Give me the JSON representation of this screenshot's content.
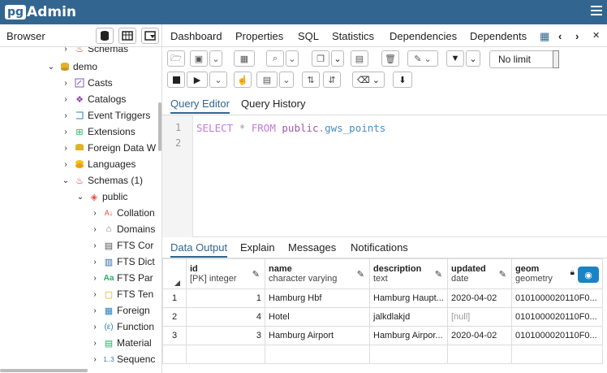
{
  "app": {
    "logo_pg": "pg",
    "logo_admin": "Admin"
  },
  "browser": {
    "title": "Browser",
    "tree": [
      {
        "label": "Schemas",
        "arrow": "›",
        "icon": "schemas-icon"
      },
      {
        "label": "demo",
        "arrow": "⌄",
        "icon": "database-icon"
      },
      {
        "label": "Casts",
        "arrow": "›",
        "icon": "casts-icon"
      },
      {
        "label": "Catalogs",
        "arrow": "›",
        "icon": "catalogs-icon"
      },
      {
        "label": "Event Triggers",
        "arrow": "›",
        "icon": "event-triggers-icon"
      },
      {
        "label": "Extensions",
        "arrow": "›",
        "icon": "extensions-icon"
      },
      {
        "label": "Foreign Data W",
        "arrow": "›",
        "icon": "foreign-data-wrapper-icon"
      },
      {
        "label": "Languages",
        "arrow": "›",
        "icon": "languages-icon"
      },
      {
        "label": "Schemas (1)",
        "arrow": "⌄",
        "icon": "schemas-icon"
      },
      {
        "label": "public",
        "arrow": "⌄",
        "icon": "schema-public-icon"
      },
      {
        "label": "Collation",
        "arrow": "›",
        "icon": "collation-icon"
      },
      {
        "label": "Domains",
        "arrow": "›",
        "icon": "domains-icon"
      },
      {
        "label": "FTS Cor",
        "arrow": "›",
        "icon": "fts-config-icon"
      },
      {
        "label": "FTS Dict",
        "arrow": "›",
        "icon": "fts-dictionary-icon"
      },
      {
        "label": "FTS Par",
        "arrow": "›",
        "icon": "fts-parser-icon"
      },
      {
        "label": "FTS Ten",
        "arrow": "›",
        "icon": "fts-template-icon"
      },
      {
        "label": "Foreign",
        "arrow": "›",
        "icon": "foreign-table-icon"
      },
      {
        "label": "Function",
        "arrow": "›",
        "icon": "function-icon"
      },
      {
        "label": "Material",
        "arrow": "›",
        "icon": "materialized-view-icon"
      },
      {
        "label": "Sequenc",
        "arrow": "›",
        "icon": "sequence-icon"
      }
    ]
  },
  "tabs": [
    "Dashboard",
    "Properties",
    "SQL",
    "Statistics",
    "Dependencies",
    "Dependents"
  ],
  "toolbar": {
    "limit": "No limit"
  },
  "editor_tabs": [
    "Query Editor",
    "Query History"
  ],
  "editor": {
    "line_numbers": [
      "1",
      "2"
    ],
    "select": "SELECT",
    "star": "*",
    "from": "FROM",
    "schema": "public",
    "dot": ".",
    "table": "gws_points"
  },
  "result_tabs": [
    "Data Output",
    "Explain",
    "Messages",
    "Notifications"
  ],
  "grid": {
    "columns": [
      {
        "name": "id",
        "type": "[PK] integer"
      },
      {
        "name": "name",
        "type": "character varying"
      },
      {
        "name": "description",
        "type": "text"
      },
      {
        "name": "updated",
        "type": "date"
      },
      {
        "name": "geom",
        "type": "geometry"
      }
    ],
    "rows": [
      {
        "n": "1",
        "id": "1",
        "name": "Hamburg Hbf",
        "description": "Hamburg Haupt...",
        "updated": "2020-04-02",
        "geom": "0101000020110F0..."
      },
      {
        "n": "2",
        "id": "4",
        "name": "Hotel",
        "description": "jalkdlakjd",
        "updated": "[null]",
        "geom": "0101000020110F0..."
      },
      {
        "n": "3",
        "id": "3",
        "name": "Hamburg Airport",
        "description": "Hamburg Airpor...",
        "updated": "2020-04-02",
        "geom": "0101000020110F0..."
      }
    ]
  }
}
